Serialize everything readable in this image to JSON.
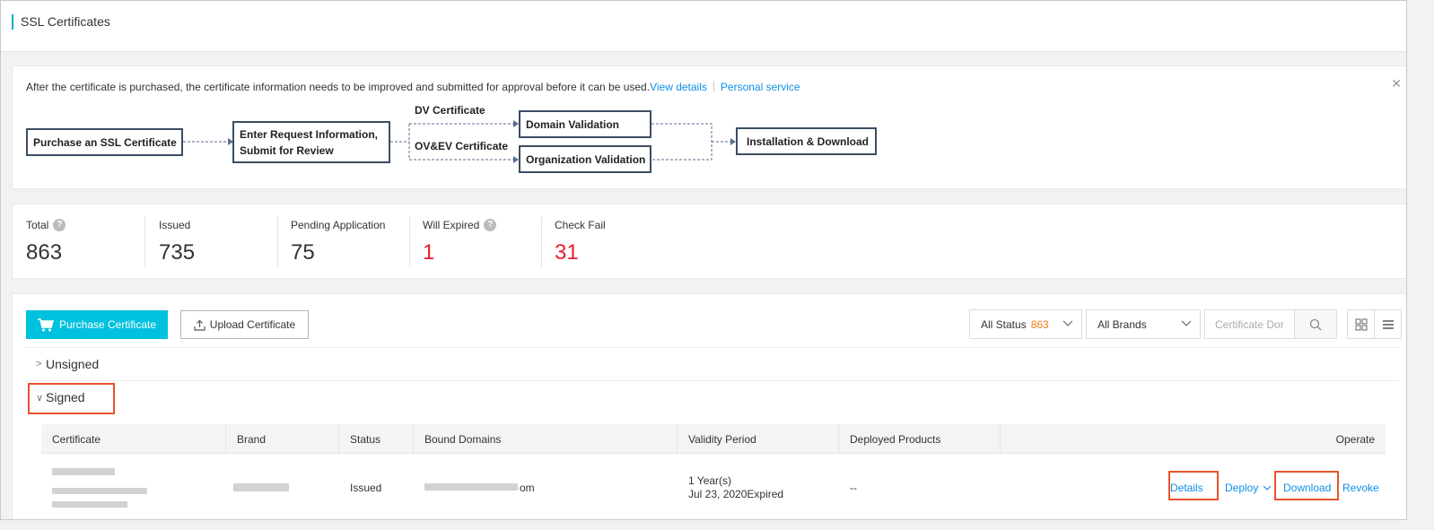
{
  "header": {
    "title": "SSL Certificates"
  },
  "notice": {
    "message": "After the certificate is purchased, the certificate information needs to be improved and submitted for approval before it can be used.",
    "link_view_details": "View details",
    "link_personal_service": "Personal service",
    "close_icon": "close-icon"
  },
  "flow": {
    "step1": "Purchase an SSL Certificate",
    "step2_line1": "Enter Request Information,",
    "step2_line2": "Submit for Review",
    "dv_label": "DV Certificate",
    "ovev_label": "OV&EV Certificate",
    "domain_validation": "Domain Validation",
    "organization_validation": "Organization Validation",
    "install": "Installation & Download",
    "line_color": "#5a6f8c"
  },
  "stats": [
    {
      "label": "Total",
      "value": "863",
      "help": true,
      "red": false
    },
    {
      "label": "Issued",
      "value": "735",
      "help": false,
      "red": false
    },
    {
      "label": "Pending Application",
      "value": "75",
      "help": false,
      "red": false
    },
    {
      "label": "Will Expired",
      "value": "1",
      "help": true,
      "red": true
    },
    {
      "label": "Check Fail",
      "value": "31",
      "help": false,
      "red": true
    }
  ],
  "toolbar": {
    "purchase_label": "Purchase Certificate",
    "upload_label": "Upload Certificate",
    "status_select": "All Status",
    "status_count": "863",
    "brand_select": "All Brands",
    "search_placeholder": "Certificate Dor"
  },
  "groups": {
    "unsigned": "Unsigned",
    "signed": "Signed"
  },
  "table": {
    "columns": [
      "Certificate",
      "Brand",
      "Status",
      "Bound Domains",
      "Validity Period",
      "Deployed Products",
      "Operate"
    ],
    "row": {
      "status": "Issued",
      "domain_suffix": "om",
      "validity_line1": "1 Year(s)",
      "validity_line2": "Jul 23, 2020Expired",
      "deployed": "--",
      "ops": {
        "details": "Details",
        "deploy": "Deploy",
        "download": "Download",
        "revoke": "Revoke"
      }
    }
  },
  "colors": {
    "accent": "#00c1de",
    "link": "#0f8fe6",
    "danger": "#e9202b",
    "highlight": "#e8532b",
    "count": "#ef7f12"
  }
}
